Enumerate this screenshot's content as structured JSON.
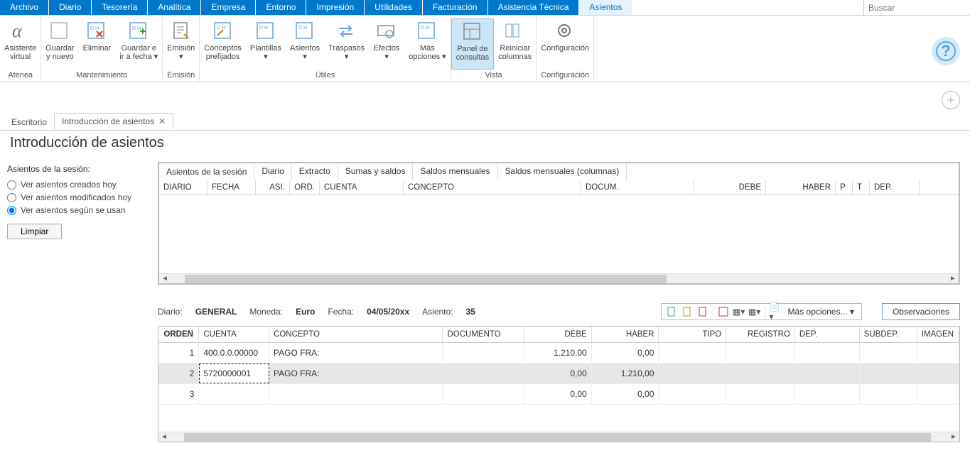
{
  "search_placeholder": "Buscar",
  "menu": [
    "Archivo",
    "Diario",
    "Tesorería",
    "Analítica",
    "Empresa",
    "Entorno",
    "Impresión",
    "Utilidades",
    "Facturación",
    "Asistencia Técnica",
    "Asientos"
  ],
  "active_menu_index": 10,
  "ribbon": {
    "groups": [
      {
        "label": "Atenea",
        "buttons": [
          {
            "label": "Asistente\nvirtual"
          }
        ]
      },
      {
        "label": "Mantenimiento",
        "buttons": [
          {
            "label": "Guardar\ny nuevo"
          },
          {
            "label": "Eliminar"
          },
          {
            "label": "Guardar e\nir a fecha ▾"
          }
        ]
      },
      {
        "label": "Emisión",
        "buttons": [
          {
            "label": "Emisión\n▾"
          }
        ]
      },
      {
        "label": "Útiles",
        "buttons": [
          {
            "label": "Conceptos\nprefijados"
          },
          {
            "label": "Plantillas\n▾"
          },
          {
            "label": "Asientos\n▾"
          },
          {
            "label": "Traspasos\n▾"
          },
          {
            "label": "Efectos\n▾"
          },
          {
            "label": "Más\nopciones ▾"
          }
        ]
      },
      {
        "label": "Vista",
        "buttons": [
          {
            "label": "Panel de\nconsultas",
            "selected": true
          },
          {
            "label": "Reiniciar\ncolumnas"
          }
        ]
      },
      {
        "label": "Configuración",
        "buttons": [
          {
            "label": "Configuración\n "
          }
        ]
      }
    ]
  },
  "doc_tabs": {
    "items": [
      "Escritorio",
      "Introducción de asientos"
    ],
    "active": 1
  },
  "page_title": "Introducción de asientos",
  "sidebar": {
    "title": "Asientos de la sesión:",
    "radios": [
      {
        "label": "Ver asientos creados hoy",
        "checked": false
      },
      {
        "label": "Ver asientos modificados hoy",
        "checked": false
      },
      {
        "label": "Ver asientos según se usan",
        "checked": true
      }
    ],
    "clean": "Limpiar"
  },
  "inner_tabs": [
    "Asientos de la sesión",
    "Diario",
    "Extracto",
    "Sumas y saldos",
    "Saldos mensuales",
    "Saldos mensuales (columnas)"
  ],
  "inner_active": 0,
  "grid1_cols": [
    "DIARIO",
    "FECHA",
    "ASI.",
    "ORD.",
    "CUENTA",
    "CONCEPTO",
    "DOCUM.",
    "DEBE",
    "HABER",
    "P",
    "T",
    "DEP."
  ],
  "meta": {
    "diario_lbl": "Diario:",
    "diario_val": "GENERAL",
    "moneda_lbl": "Moneda:",
    "moneda_val": "Euro",
    "fecha_lbl": "Fecha:",
    "fecha_val": "04/05/20xx",
    "asiento_lbl": "Asiento:",
    "asiento_val": "35",
    "more_opts": "Más opciones...",
    "obs": "Observaciones"
  },
  "grid2_cols": [
    "ORDEN",
    "CUENTA",
    "CONCEPTO",
    "DOCUMENTO",
    "DEBE",
    "HABER",
    "TIPO",
    "REGISTRO",
    "DEP.",
    "SUBDEP.",
    "IMAGEN"
  ],
  "grid2_rows": [
    {
      "orden": "1",
      "cuenta": "400.0.0.00000",
      "concepto": "PAGO FRA:",
      "documento": "",
      "debe": "1.210,00",
      "haber": "0,00",
      "tipo": "",
      "registro": "",
      "dep": "",
      "subdep": "",
      "imagen": ""
    },
    {
      "orden": "2",
      "cuenta": "5720000001",
      "concepto": "PAGO FRA:",
      "documento": "",
      "debe": "0,00",
      "haber": "1.210,00",
      "tipo": "",
      "registro": "",
      "dep": "",
      "subdep": "",
      "imagen": "",
      "selected": true
    },
    {
      "orden": "3",
      "cuenta": "",
      "concepto": "",
      "documento": "",
      "debe": "0,00",
      "haber": "0,00",
      "tipo": "",
      "registro": "",
      "dep": "",
      "subdep": "",
      "imagen": ""
    }
  ]
}
